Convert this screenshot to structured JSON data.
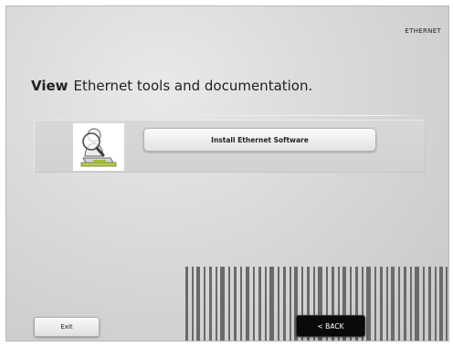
{
  "header": {
    "section": "ETHERNET"
  },
  "main": {
    "heading_strong": "View",
    "heading_text": "Ethernet tools and documentation.",
    "install_button": "Install Ethernet Software",
    "icon": "user-magnifier-icon"
  },
  "footer": {
    "exit_label": "Exit",
    "back_label": "< BACK"
  }
}
